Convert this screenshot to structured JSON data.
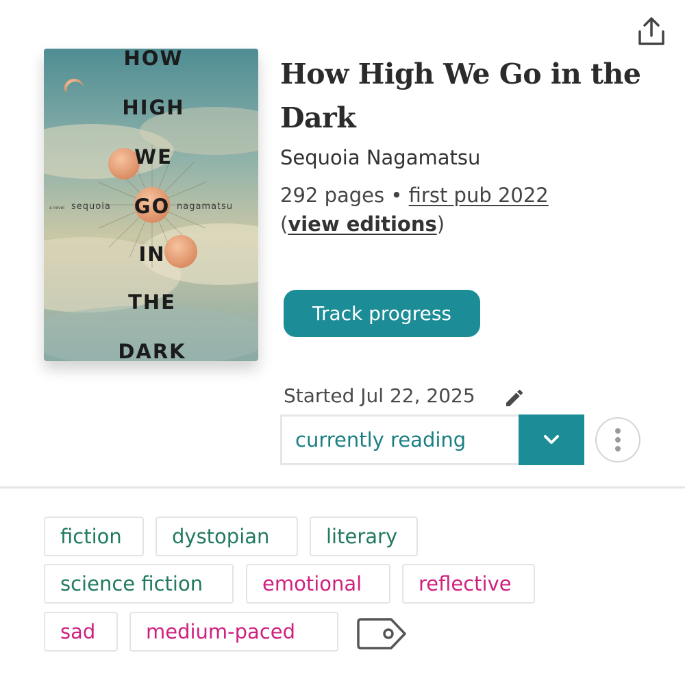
{
  "book": {
    "title": "How High We Go in the Dark",
    "author": "Sequoia Nagamatsu",
    "pages": "292 pages",
    "separator": "•",
    "first_pub": "first pub 2022",
    "editions_open": "(",
    "view_editions": "view editions",
    "editions_close": ")"
  },
  "cover": {
    "title_words": [
      "HOW",
      "HIGH",
      "WE",
      "GO",
      "IN",
      "THE",
      "DARK"
    ],
    "small_label": "a novel",
    "author_first": "sequoia",
    "author_last": "nagamatsu"
  },
  "actions": {
    "track_progress": "Track progress",
    "started": "Started Jul 22, 2025",
    "status": "currently reading"
  },
  "tags": [
    {
      "label": "fiction",
      "kind": "genre"
    },
    {
      "label": "dystopian",
      "kind": "genre"
    },
    {
      "label": "literary",
      "kind": "genre"
    },
    {
      "label": "science fiction",
      "kind": "genre"
    },
    {
      "label": "emotional",
      "kind": "mood"
    },
    {
      "label": "reflective",
      "kind": "mood"
    },
    {
      "label": "sad",
      "kind": "mood"
    },
    {
      "label": "medium-paced",
      "kind": "mood"
    }
  ],
  "icons": {
    "share": "share-icon",
    "edit": "pencil-icon",
    "dropdown": "chevron-down-icon",
    "more": "vertical-dots-icon",
    "add_tag": "tag-icon"
  },
  "colors": {
    "accent": "#1c8c96",
    "genre_tag": "#227a61",
    "mood_tag": "#d0207f"
  }
}
